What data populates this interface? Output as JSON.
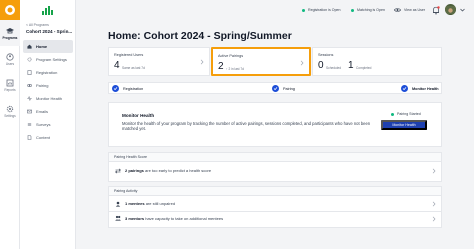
{
  "rail": {
    "items": [
      {
        "label": "Programs",
        "icon": "graduation-cap-icon",
        "active": true
      },
      {
        "label": "Users",
        "icon": "users-icon",
        "active": false
      },
      {
        "label": "Reports",
        "icon": "reports-icon",
        "active": false
      },
      {
        "label": "Settings",
        "icon": "gear-icon",
        "active": false
      }
    ]
  },
  "sidebar": {
    "breadcrumb": "< All Programs",
    "program_title": "Cohort 2024 - Spring/Summer",
    "program_title_display": "Cohort 2024 - Sprin...",
    "items": [
      {
        "label": "Home",
        "active": true
      },
      {
        "label": "Program Settings",
        "active": false
      },
      {
        "label": "Registration",
        "active": false
      },
      {
        "label": "Pairing",
        "active": false
      },
      {
        "label": "Monitor Health",
        "active": false
      },
      {
        "label": "Emails",
        "active": false
      },
      {
        "label": "Surveys",
        "active": false
      },
      {
        "label": "Content",
        "active": false
      }
    ]
  },
  "header": {
    "registration_status": "Registration is Open",
    "matching_status": "Matching is Open",
    "view_as_user": "View as User",
    "status_color": "#10b981"
  },
  "page": {
    "title": "Home: Cohort 2024 - Spring/Summer"
  },
  "stats": {
    "registered": {
      "label": "Registered Users",
      "value": "4",
      "sub": "Same as last 7d"
    },
    "active_pairings": {
      "label": "Active Pairings",
      "value": "2",
      "sub": "↑ 2 in last 7d"
    },
    "sessions": {
      "label": "Sessions",
      "scheduled_value": "0",
      "scheduled_label": "Scheduled",
      "completed_value": "1",
      "completed_label": "Completed"
    }
  },
  "steps": [
    {
      "label": "Registration",
      "current": false
    },
    {
      "label": "Pairing",
      "current": false
    },
    {
      "label": "Monitor Health",
      "current": true
    }
  ],
  "monitor": {
    "title": "Monitor Health",
    "description": "Monitor the health of your program by tracking the number of active pairings, sessions completed, and participants who have not been matched yet.",
    "status": "Pairing Started",
    "button": "Monitor Health"
  },
  "health_score": {
    "header": "Pairing Health Score",
    "text_bold": "2 pairings",
    "text_rest": " are too early to predict a health score"
  },
  "activity": {
    "header": "Pairing Activity",
    "rows": [
      {
        "bold": "1 mentees",
        "rest": " are still unpaired"
      },
      {
        "bold": "3 mentors",
        "rest": " have capacity to take on additional mentees"
      }
    ]
  },
  "colors": {
    "accent": "#f59e0b",
    "primary": "#1e40af",
    "success": "#10b981"
  }
}
